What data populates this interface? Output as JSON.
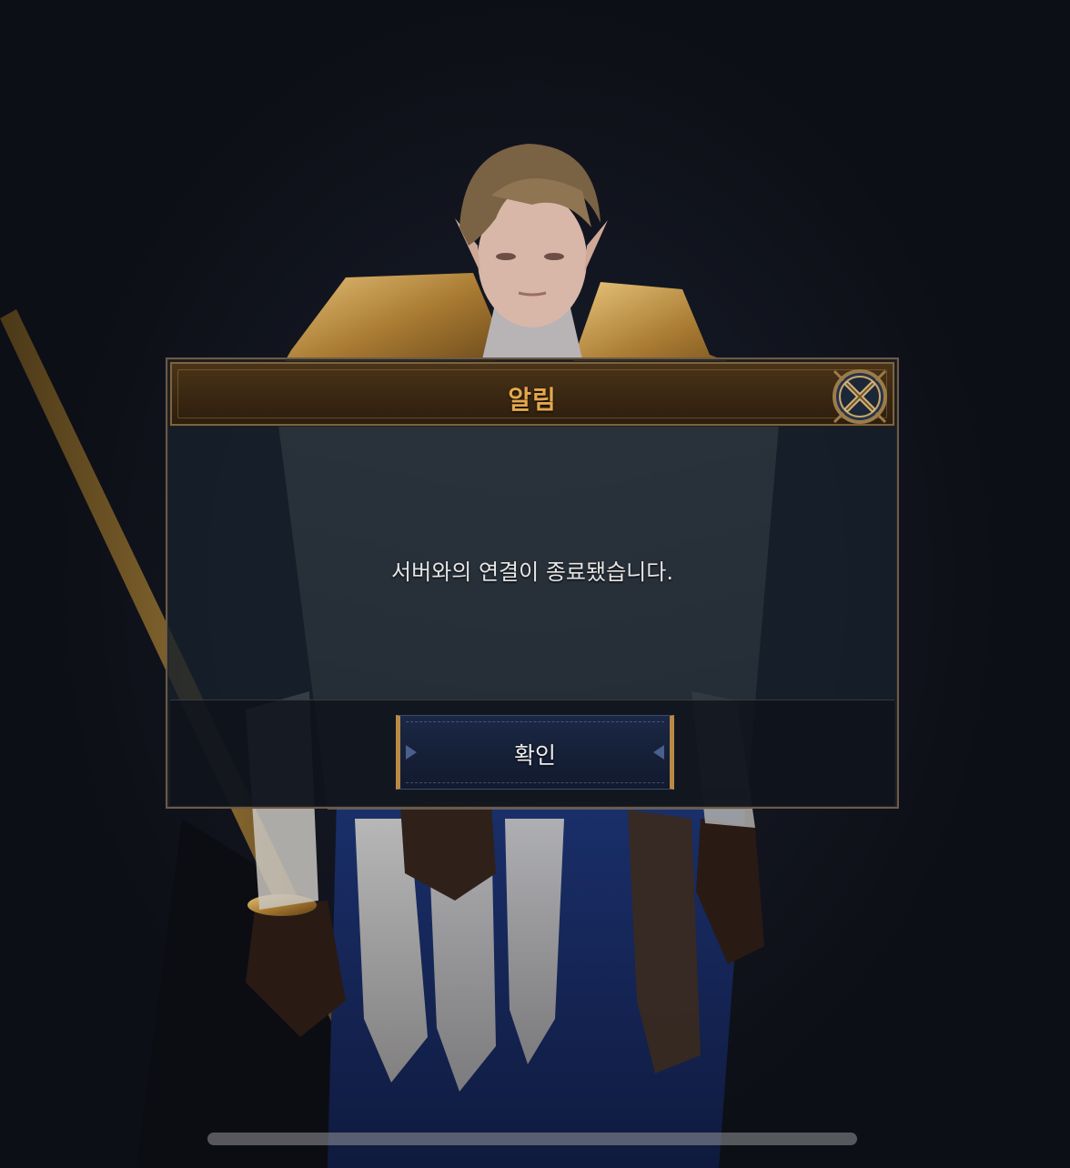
{
  "dialog": {
    "title": "알림",
    "message": "서버와의 연결이 종료됐습니다.",
    "confirm_label": "확인",
    "close_icon": "close-x-icon"
  },
  "colors": {
    "title_gold": "#e3a84c",
    "header_brown": "#3a2712",
    "button_navy": "#162038",
    "button_trim_gold": "#b98a45",
    "message_text": "#e6e6e6"
  }
}
